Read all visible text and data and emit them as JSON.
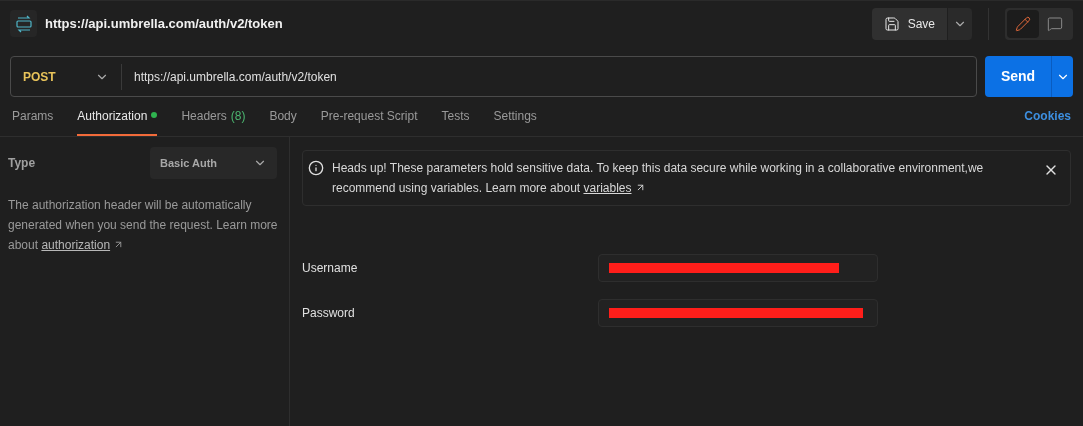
{
  "header": {
    "title": "https://api.umbrella.com/auth/v2/token",
    "save_label": "Save",
    "modes": [
      {
        "kind": "edit",
        "selected": true
      },
      {
        "kind": "comments",
        "selected": false
      }
    ]
  },
  "request": {
    "method": "POST",
    "url": "https://api.umbrella.com/auth/v2/token",
    "send_label": "Send"
  },
  "tabs": [
    {
      "label": "Params",
      "selected": false
    },
    {
      "label": "Authorization",
      "selected": true,
      "dot": true
    },
    {
      "label": "Headers",
      "count": "(8)",
      "selected": false
    },
    {
      "label": "Body",
      "selected": false
    },
    {
      "label": "Pre-request Script",
      "selected": false
    },
    {
      "label": "Tests",
      "selected": false
    },
    {
      "label": "Settings",
      "selected": false
    }
  ],
  "cookies_link": "Cookies",
  "auth": {
    "type_label": "Type",
    "type_value": "Basic Auth",
    "description": "The authorization header will be automatically generated when you send the request. Learn more about ",
    "description_link": "authorization"
  },
  "alert": {
    "text": "Heads up! These parameters hold sensitive data. To keep this data secure while working in a collaborative environment,we recommend using variables. Learn more about ",
    "link": "variables"
  },
  "fields": [
    {
      "label": "Username",
      "redacted": true
    },
    {
      "label": "Password",
      "redacted": true
    }
  ]
}
